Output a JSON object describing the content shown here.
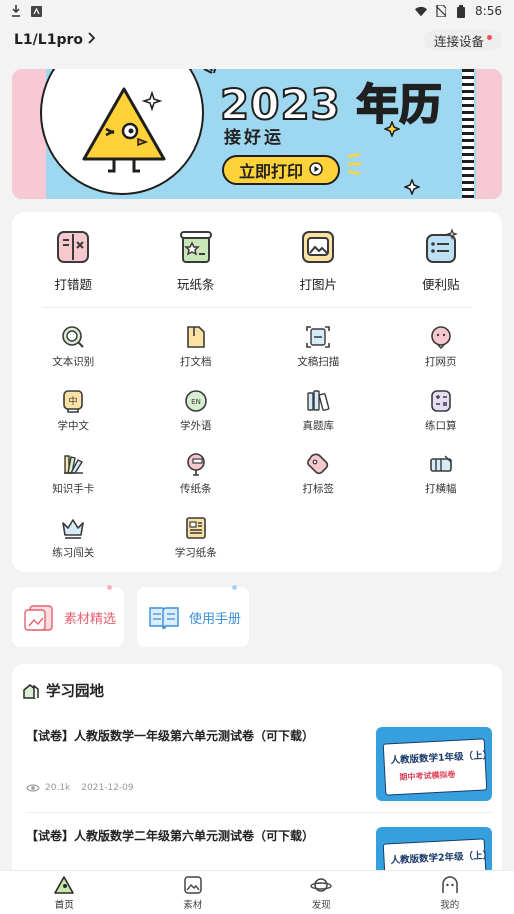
{
  "status": {
    "time": "8:56"
  },
  "header": {
    "device": "L1/L1pro",
    "connect_label": "连接设备"
  },
  "banner": {
    "year": "2023 年历",
    "slogan": "接好运",
    "button_label": "立即打印"
  },
  "main_features": [
    {
      "label": "打错题",
      "icon": "wrong-question-icon"
    },
    {
      "label": "玩纸条",
      "icon": "paper-strip-icon"
    },
    {
      "label": "打图片",
      "icon": "picture-icon"
    },
    {
      "label": "便利贴",
      "icon": "sticky-note-icon"
    }
  ],
  "tools": [
    {
      "label": "文本识别",
      "icon": "text-recognition-icon"
    },
    {
      "label": "打文档",
      "icon": "document-icon"
    },
    {
      "label": "文稿扫描",
      "icon": "scan-icon"
    },
    {
      "label": "打网页",
      "icon": "webpage-icon"
    },
    {
      "label": "学中文",
      "icon": "chinese-icon"
    },
    {
      "label": "学外语",
      "icon": "foreign-language-icon"
    },
    {
      "label": "真题库",
      "icon": "question-bank-icon"
    },
    {
      "label": "练口算",
      "icon": "mental-math-icon"
    },
    {
      "label": "知识手卡",
      "icon": "knowledge-card-icon"
    },
    {
      "label": "传纸条",
      "icon": "pass-note-icon"
    },
    {
      "label": "打标签",
      "icon": "label-icon"
    },
    {
      "label": "打横幅",
      "icon": "banner-icon"
    },
    {
      "label": "练习闯关",
      "icon": "challenge-crown-icon"
    },
    {
      "label": "学习纸条",
      "icon": "study-strip-icon"
    }
  ],
  "shortcuts": {
    "materials": "素材精选",
    "manual": "使用手册"
  },
  "study": {
    "title": "学习园地",
    "articles": [
      {
        "title": "【试卷】人教版数学一年级第六单元测试卷（可下载）",
        "views": "20.1k",
        "date": "2021-12-09",
        "thumb_title": "人教版数学1年级（上）",
        "thumb_sub": "期中考试模拟卷"
      },
      {
        "title": "【试卷】人教版数学二年级第六单元测试卷（可下载）",
        "thumb_title": "人教版数学2年级（上）"
      }
    ]
  },
  "tabs": [
    {
      "label": "首页",
      "icon": "home-icon"
    },
    {
      "label": "素材",
      "icon": "materials-icon"
    },
    {
      "label": "发现",
      "icon": "discover-icon"
    },
    {
      "label": "我的",
      "icon": "profile-icon"
    }
  ],
  "colors": {
    "accent_red": "#f0555a",
    "banner_blue": "#9ed8f0",
    "banner_pink": "#f6c9d4",
    "banner_yellow": "#ffd23a",
    "manual_blue": "#3b8fd8",
    "materials_red": "#e9606e"
  }
}
